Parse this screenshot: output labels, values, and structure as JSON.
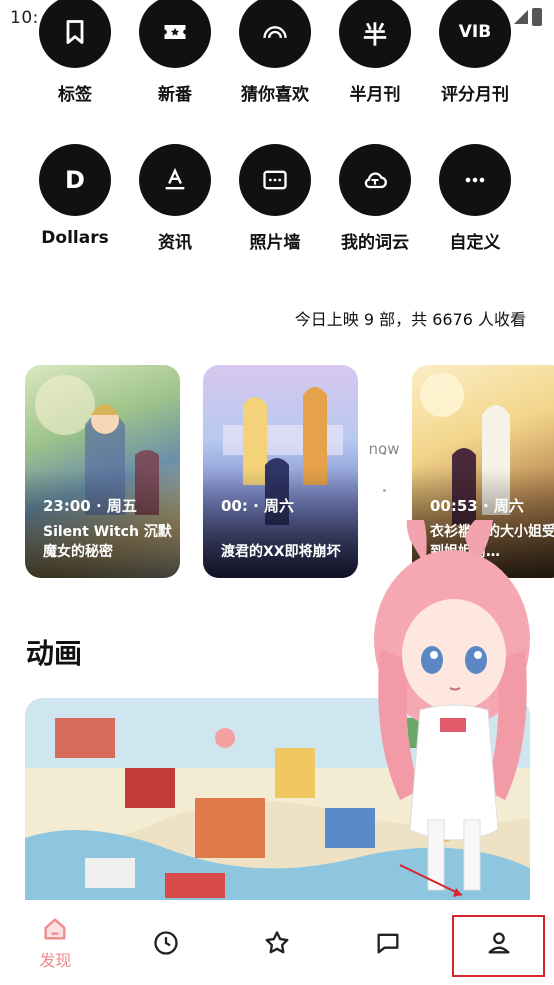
{
  "status_bar": {
    "time": "10:"
  },
  "grid": {
    "row1": [
      {
        "icon": "bookmark-icon",
        "label": "标签"
      },
      {
        "icon": "ticket-star-icon",
        "label": "新番"
      },
      {
        "icon": "rainbow-icon",
        "label": "猜你喜欢"
      },
      {
        "icon": "half-icon",
        "glyph": "半",
        "label": "半月刊"
      },
      {
        "icon": "vib-icon",
        "glyph": "VIB",
        "label": "评分月刊"
      }
    ],
    "row2": [
      {
        "icon": "dollars-icon",
        "glyph": "D",
        "label": "Dollars"
      },
      {
        "icon": "news-icon",
        "glyph": "A",
        "label": "资讯"
      },
      {
        "icon": "photo-wall-icon",
        "label": "照片墙"
      },
      {
        "icon": "word-cloud-icon",
        "label": "我的词云"
      },
      {
        "icon": "more-icon",
        "label": "自定义"
      }
    ]
  },
  "today": {
    "summary": "今日上映 9 部，共 6676 人收看"
  },
  "now_label": "now",
  "cards": [
    {
      "time": "23:00 · 周五",
      "title": "Silent Witch 沉默魔女的秘密"
    },
    {
      "time": "00: · 周六",
      "title": "渡君的XX即将崩坏"
    },
    {
      "time": "00:53 · 周六",
      "title": "衣衫褴褛的大小姐受到姐姐前…"
    }
  ],
  "section": {
    "title": "动画"
  },
  "bottom_nav": {
    "items": [
      {
        "icon": "home-icon",
        "label": "发现",
        "active": true
      },
      {
        "icon": "clock-icon",
        "label": ""
      },
      {
        "icon": "star-icon",
        "label": ""
      },
      {
        "icon": "chat-icon",
        "label": ""
      },
      {
        "icon": "user-icon",
        "label": ""
      }
    ]
  },
  "colors": {
    "accent": "#ef8a8a",
    "highlight": "#d7262b",
    "circle": "#111111"
  }
}
